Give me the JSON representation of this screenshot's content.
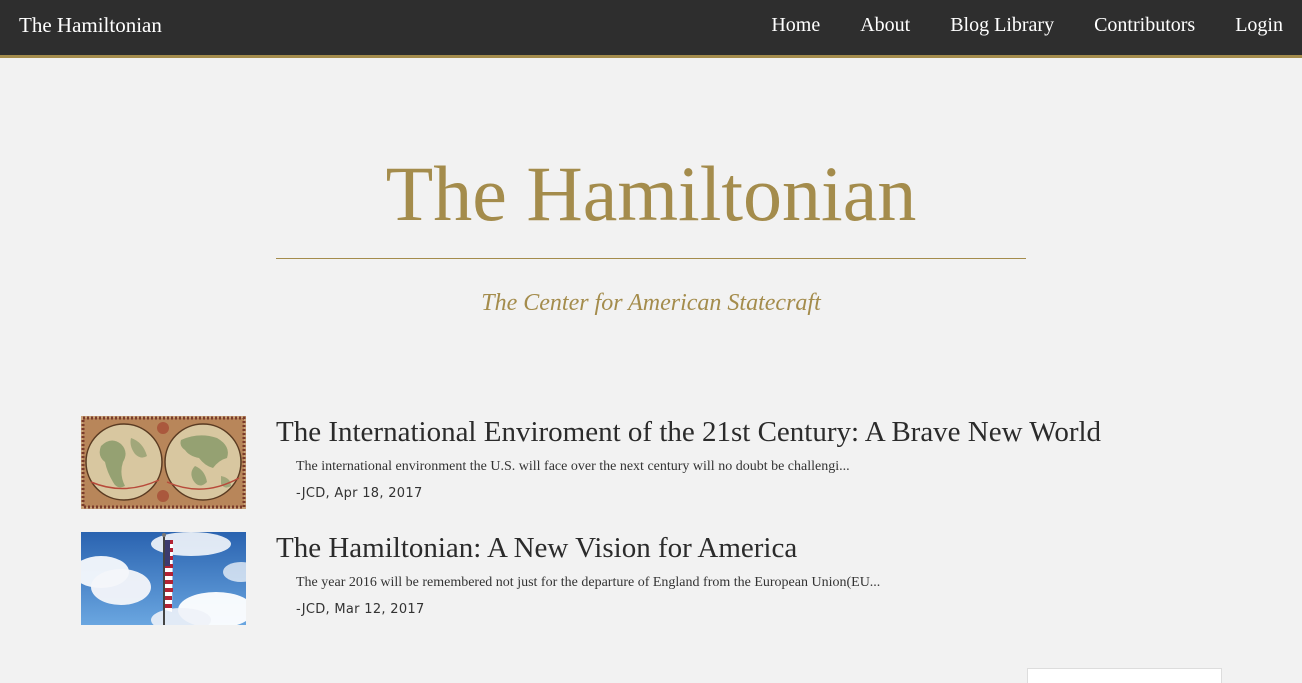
{
  "navbar": {
    "brand": "The Hamiltonian",
    "links": [
      {
        "label": "Home"
      },
      {
        "label": "About"
      },
      {
        "label": "Blog Library"
      },
      {
        "label": "Contributors"
      },
      {
        "label": "Login"
      }
    ]
  },
  "hero": {
    "title": "The Hamiltonian",
    "subtitle": "The Center for American Statecraft"
  },
  "posts": [
    {
      "title": "The International Enviroment of the 21st Century: A Brave New World",
      "excerpt": "The international environment the U.S. will face over the next century will no doubt be challengi...",
      "meta": "-JCD, Apr 18, 2017",
      "thumbnail": "antique-world-map-image"
    },
    {
      "title": "The Hamiltonian: A New Vision for America",
      "excerpt": "The year 2016 will be remembered not just for the departure of England from the European Union(EU...",
      "meta": "-JCD, Mar 12, 2017",
      "thumbnail": "american-flag-sky-image"
    }
  ],
  "colors": {
    "navbar_bg": "#2e2e2e",
    "accent_gold": "#a48c4c",
    "page_bg": "#f2f2f2",
    "text_dark": "#2b2b2b"
  }
}
